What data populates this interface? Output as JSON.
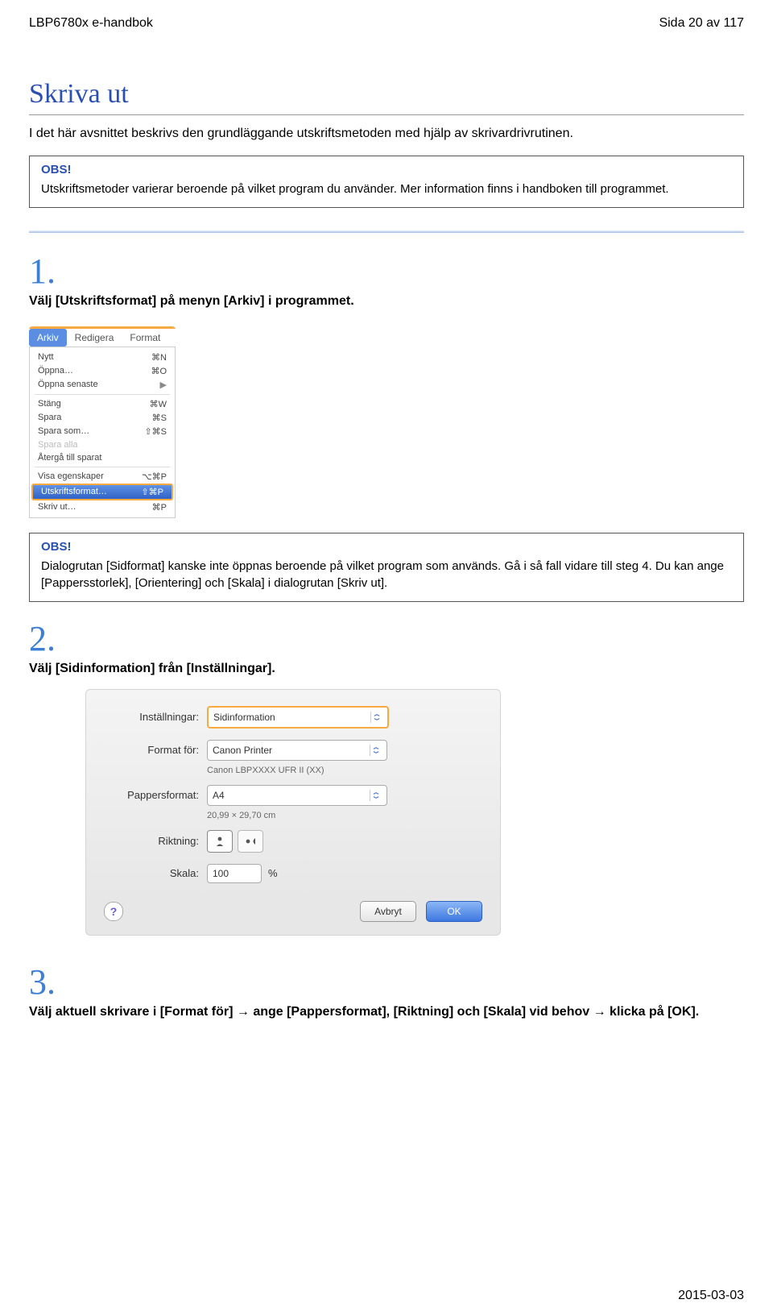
{
  "header": {
    "left": "LBP6780x e-handbok",
    "right": "Sida 20 av 117"
  },
  "title": "Skriva ut",
  "intro": "I det här avsnittet beskrivs den grundläggande utskriftsmetoden med hjälp av skrivardrivrutinen.",
  "obs1": {
    "title": "OBS!",
    "body": "Utskriftsmetoder varierar beroende på vilket program du använder. Mer information finns i handboken till programmet."
  },
  "step1": {
    "num": "1.",
    "text": "Välj [Utskriftsformat] på menyn [Arkiv] i programmet."
  },
  "menu": {
    "bar": [
      "Arkiv",
      "Redigera",
      "Format"
    ],
    "items": [
      {
        "l": "Nytt",
        "r": "⌘N"
      },
      {
        "l": "Öppna…",
        "r": "⌘O"
      },
      {
        "l": "Öppna senaste",
        "r": "▶"
      },
      {
        "sep": true
      },
      {
        "l": "Stäng",
        "r": "⌘W"
      },
      {
        "l": "Spara",
        "r": "⌘S"
      },
      {
        "l": "Spara som…",
        "r": "⇧⌘S"
      },
      {
        "l": "Spara alla",
        "r": "",
        "dis": true
      },
      {
        "l": "Återgå till sparat",
        "r": ""
      },
      {
        "sep": true
      },
      {
        "l": "Visa egenskaper",
        "r": "⌥⌘P"
      },
      {
        "l": "Utskriftsformat…",
        "r": "⇧⌘P",
        "hi": true
      },
      {
        "l": "Skriv ut…",
        "r": "⌘P"
      }
    ]
  },
  "obs2": {
    "title": "OBS!",
    "body": "Dialogrutan [Sidformat] kanske inte öppnas beroende på vilket program som används. Gå i så fall vidare till steg 4. Du kan ange [Pappersstorlek], [Orientering] och [Skala] i dialogrutan [Skriv ut]."
  },
  "step2": {
    "num": "2.",
    "text": "Välj [Sidinformation] från [Inställningar]."
  },
  "dialog": {
    "labels": {
      "installningar": "Inställningar:",
      "format_for": "Format för:",
      "pappersformat": "Pappersformat:",
      "riktning": "Riktning:",
      "skala": "Skala:"
    },
    "installningar": "Sidinformation",
    "format_for": "Canon Printer",
    "format_for_sub": "Canon LBPXXXX UFR II (XX)",
    "pappersformat": "A4",
    "pappersformat_sub": "20,99 × 29,70 cm",
    "skala": "100",
    "skala_suffix": "%",
    "help": "?",
    "buttons": {
      "cancel": "Avbryt",
      "ok": "OK"
    }
  },
  "step3": {
    "num": "3.",
    "text": "Välj aktuell skrivare i [Format för] → ange [Pappersformat], [Riktning] och [Skala] vid behov → klicka på [OK]."
  },
  "footer": "2015-03-03"
}
